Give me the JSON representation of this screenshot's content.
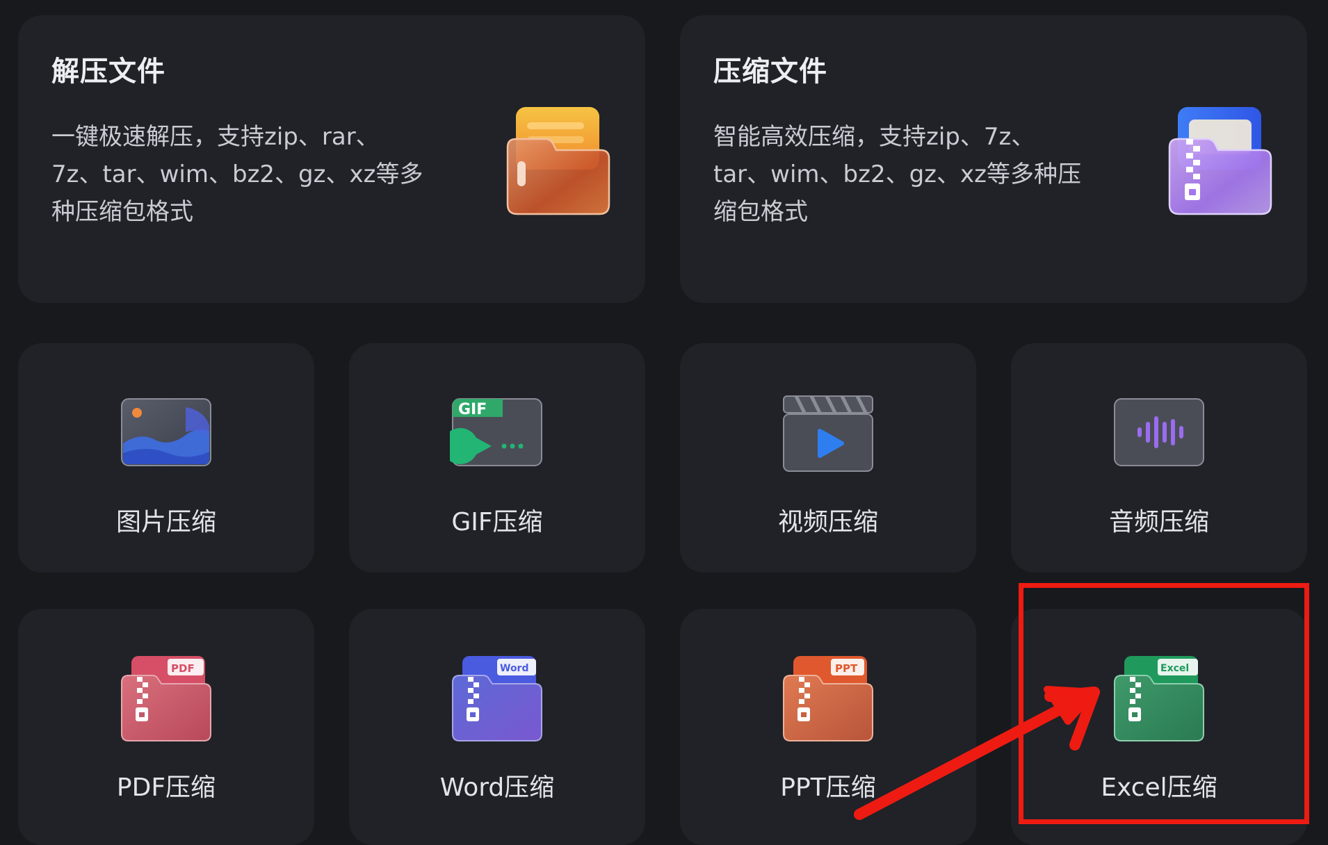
{
  "feature_cards": [
    {
      "title": "解压文件",
      "description_lines": [
        "一键极速解压，支持zip、rar、",
        "7z、tar、wim、bz2、gz、xz等多",
        "种压缩包格式"
      ],
      "icon": "orange-folder-icon"
    },
    {
      "title": "压缩文件",
      "description_lines": [
        "智能高效压缩，支持zip、7z、",
        "tar、wim、bz2、gz、xz等多种压",
        "缩包格式"
      ],
      "icon": "purple-zip-folder-icon"
    }
  ],
  "tiles": [
    {
      "label": "图片压缩",
      "icon": "image-icon"
    },
    {
      "label": "GIF压缩",
      "icon": "gif-icon",
      "badge": "GIF"
    },
    {
      "label": "视频压缩",
      "icon": "video-clapper-icon"
    },
    {
      "label": "音频压缩",
      "icon": "audio-wave-icon"
    },
    {
      "label": "PDF压缩",
      "icon": "pdf-zip-folder-icon",
      "badge": "PDF"
    },
    {
      "label": "Word压缩",
      "icon": "word-zip-folder-icon",
      "badge": "Word"
    },
    {
      "label": "PPT压缩",
      "icon": "ppt-zip-folder-icon",
      "badge": "PPT"
    },
    {
      "label": "Excel压缩",
      "icon": "excel-zip-folder-icon",
      "badge": "Excel"
    }
  ],
  "colors": {
    "background": "#17191d",
    "card": "#202227",
    "highlight": "#ee1b12"
  }
}
